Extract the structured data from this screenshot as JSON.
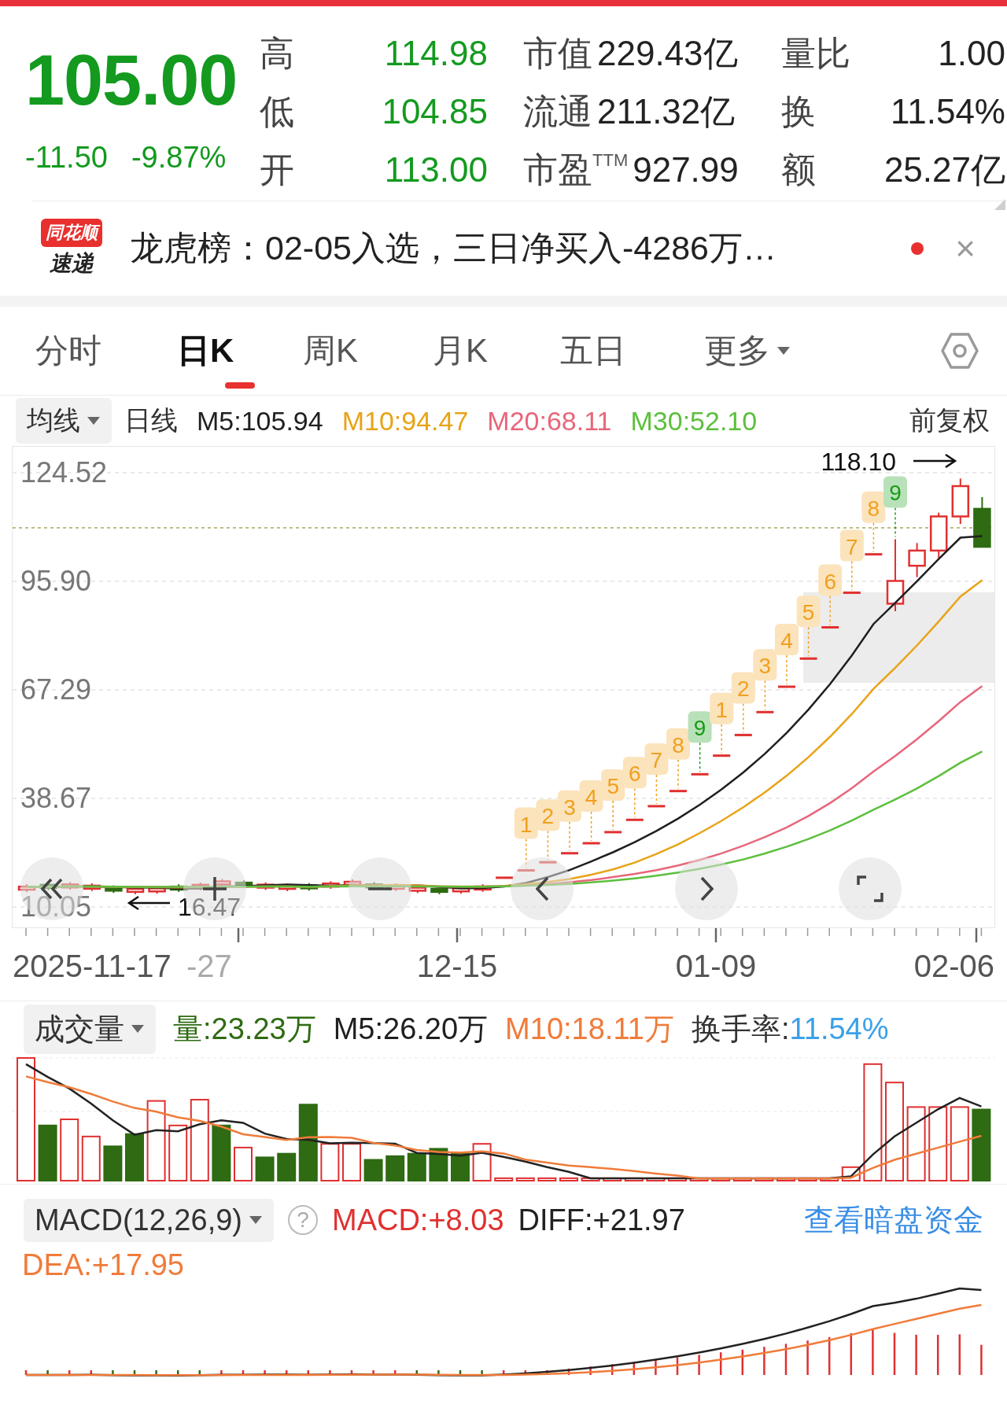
{
  "quote": {
    "price": "105.00",
    "change": "-11.50",
    "change_pct": "-9.87%"
  },
  "stat_groups": [
    {
      "kind": "price",
      "items": [
        {
          "label": "高",
          "value": "114.98"
        },
        {
          "label": "低",
          "value": "104.85"
        },
        {
          "label": "开",
          "value": "113.00"
        }
      ]
    },
    {
      "kind": "inline",
      "items": [
        {
          "label": "市值",
          "value": "229.43亿"
        },
        {
          "label": "流通",
          "value": "211.32亿"
        },
        {
          "label": "市盈$^{TTM}$",
          "value": "927.99"
        }
      ]
    },
    {
      "kind": "spread",
      "items": [
        {
          "label": "量比",
          "value": "1.00"
        },
        {
          "label": "换",
          "value": "11.54%"
        },
        {
          "label": "额",
          "value": "25.27亿"
        }
      ]
    }
  ],
  "news": {
    "source_top": "同花顺",
    "source_bottom": "速递",
    "text": "龙虎榜：02-05入选，三日净买入-4286万…",
    "unread": true,
    "close": "×"
  },
  "tabs": [
    {
      "label": "分时",
      "selected": false,
      "kind": "tab"
    },
    {
      "label": "日K",
      "selected": true,
      "kind": "tab"
    },
    {
      "label": "周K",
      "selected": false,
      "kind": "tab"
    },
    {
      "label": "月K",
      "selected": false,
      "kind": "tab"
    },
    {
      "label": "五日",
      "selected": false,
      "kind": "tab"
    },
    {
      "label": "更多",
      "selected": false,
      "kind": "dropdown"
    }
  ],
  "ma_bar": {
    "selector": "均线",
    "period": "日线",
    "averages": [
      {
        "label": "M5:105.94",
        "color": "#1f1f1f"
      },
      {
        "label": "M10:94.47",
        "color": "#e8a317"
      },
      {
        "label": "M20:68.11",
        "color": "#e8667a"
      },
      {
        "label": "M30:52.10",
        "color": "#5cbf3c"
      }
    ],
    "adjust": "前复权"
  },
  "kline": {
    "y_labels": [
      "124.52",
      "95.90",
      "67.29",
      "38.67",
      "10.05"
    ],
    "high_mark": "118.10",
    "low_mark": "16.47",
    "td_marks": [
      {
        "label": "1",
        "color": "#f0a020"
      },
      {
        "label": "2",
        "color": "#f0a020"
      },
      {
        "label": "3",
        "color": "#f0a020"
      },
      {
        "label": "4",
        "color": "#f0a020"
      },
      {
        "label": "5",
        "color": "#f0a020"
      },
      {
        "label": "6",
        "color": "#f0a020"
      },
      {
        "label": "7",
        "color": "#f0a020"
      },
      {
        "label": "8",
        "color": "#f0a020"
      },
      {
        "label": "9",
        "color": "#169b16"
      },
      {
        "label": "1",
        "color": "#f0a020"
      },
      {
        "label": "2",
        "color": "#f0a020"
      },
      {
        "label": "3",
        "color": "#f0a020"
      },
      {
        "label": "4",
        "color": "#f0a020"
      },
      {
        "label": "5",
        "color": "#f0a020"
      },
      {
        "label": "6",
        "color": "#f0a020"
      },
      {
        "label": "7",
        "color": "#f0a020"
      },
      {
        "label": "8",
        "color": "#f0a020"
      },
      {
        "label": "9",
        "color": "#169b16"
      }
    ],
    "x_labels": [
      {
        "label": "2025-11-17",
        "faded": false
      },
      {
        "label": "-27",
        "faded": true
      },
      {
        "label": "12-15",
        "faded": false
      },
      {
        "label": "01-09",
        "faded": false
      },
      {
        "label": "02-06",
        "faded": false
      }
    ]
  },
  "volume": {
    "selector": "成交量",
    "stats": [
      {
        "label": "量:23.23万",
        "color": "#2e6b12"
      },
      {
        "label": "M5:26.20万",
        "color": "#1f1f1f"
      },
      {
        "label": "M10:18.11万",
        "color": "#f07b3a"
      }
    ],
    "turnover": {
      "label": "换手率:",
      "value": "11.54%"
    }
  },
  "macd": {
    "selector": "MACD(12,26,9)",
    "help": "?",
    "macd": "MACD:+8.03",
    "diff": "DIFF:+21.97",
    "dea": "DEA:+17.95",
    "link": "查看暗盘资金"
  }
}
